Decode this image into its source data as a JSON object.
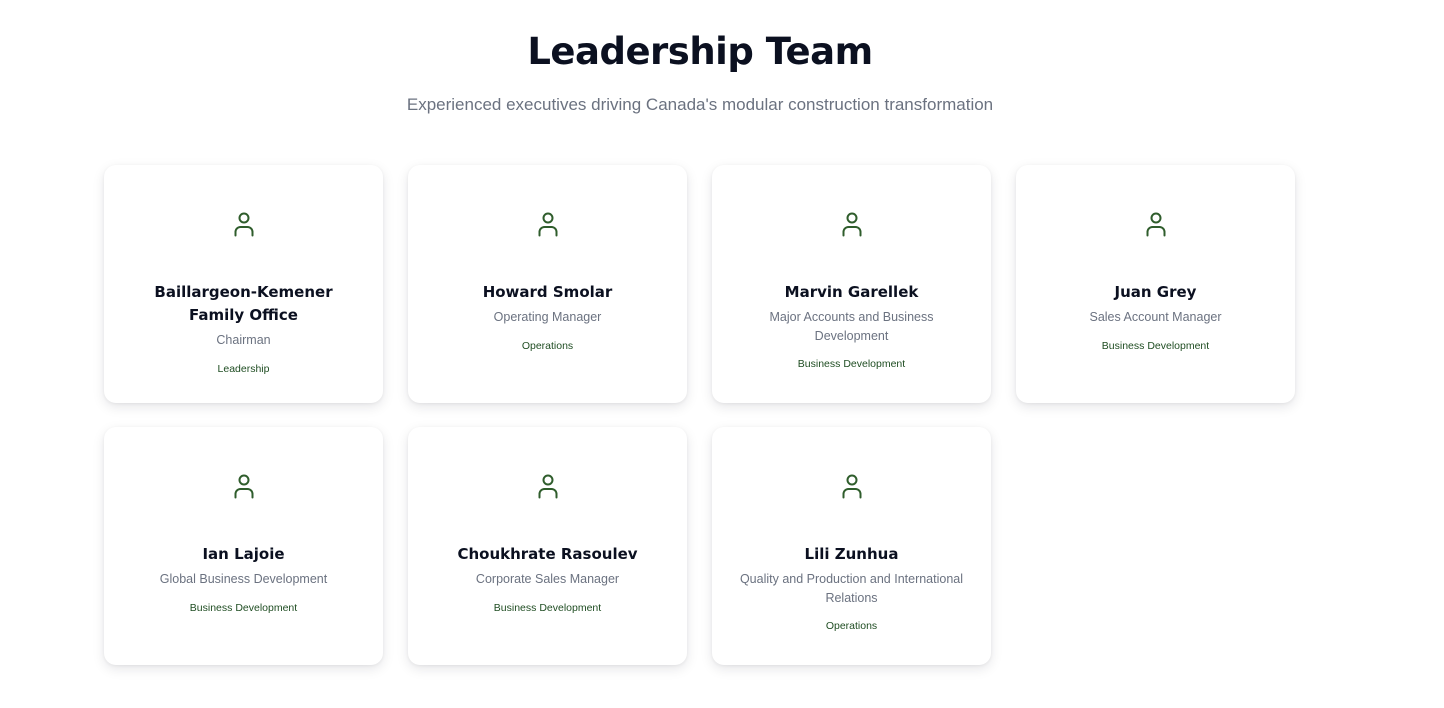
{
  "header": {
    "title": "Leadership Team",
    "subtitle": "Experienced executives driving Canada's modular construction transformation"
  },
  "colors": {
    "accent": "#2f5d2c",
    "title": "#0b1020",
    "muted": "#6b7280"
  },
  "members": [
    {
      "icon": "user-icon",
      "name": "Baillargeon-Kemener Family Office",
      "role": "Chairman",
      "department": "Leadership"
    },
    {
      "icon": "user-icon",
      "name": "Howard Smolar",
      "role": "Operating Manager",
      "department": "Operations"
    },
    {
      "icon": "user-icon",
      "name": "Marvin Garellek",
      "role": "Major Accounts and Business Development",
      "department": "Business Development"
    },
    {
      "icon": "user-icon",
      "name": "Juan Grey",
      "role": "Sales Account Manager",
      "department": "Business Development"
    },
    {
      "icon": "user-icon",
      "name": "Ian Lajoie",
      "role": "Global Business Development",
      "department": "Business Development"
    },
    {
      "icon": "user-icon",
      "name": "Choukhrate Rasoulev",
      "role": "Corporate Sales Manager",
      "department": "Business Development"
    },
    {
      "icon": "user-icon",
      "name": "Lili Zunhua",
      "role": "Quality and Production and International Relations",
      "department": "Operations"
    }
  ]
}
